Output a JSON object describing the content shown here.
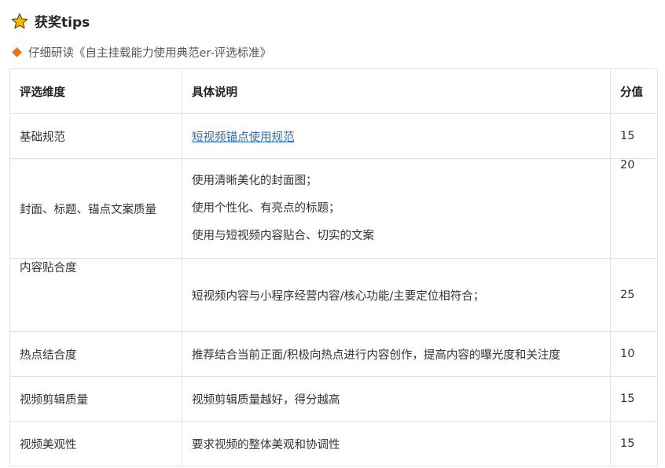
{
  "header": {
    "title": "获奖tips",
    "subtitle": "仔细研读《自主挂载能力使用典范er-评选标准》",
    "star_color": "#f5b700",
    "diamond_color": "#e8741c"
  },
  "table": {
    "columns": [
      "评选维度",
      "具体说明",
      "分值"
    ],
    "rows": [
      {
        "dimension": "基础规范",
        "description": [
          "短视频锚点使用规范"
        ],
        "score": "15"
      },
      {
        "dimension": "封面、标题、锚点文案质量",
        "description": [
          "使用清晰美化的封面图；",
          "使用个性化、有亮点的标题；",
          "使用与短视频内容贴合、切实的文案"
        ],
        "score": "20"
      },
      {
        "dimension": "内容贴合度",
        "description": [
          "短视频内容与小程序经营内容/核心功能/主要定位相符合；"
        ],
        "score": "25"
      },
      {
        "dimension": "热点结合度",
        "description": [
          "推荐结合当前正面/积极向热点进行内容创作，提高内容的曝光度和关注度"
        ],
        "score": "10"
      },
      {
        "dimension": "视频剪辑质量",
        "description": [
          "视频剪辑质量越好，得分越高"
        ],
        "score": "15"
      },
      {
        "dimension": "视频美观性",
        "description": [
          "要求视频的整体美观和协调性"
        ],
        "score": "15"
      }
    ]
  }
}
